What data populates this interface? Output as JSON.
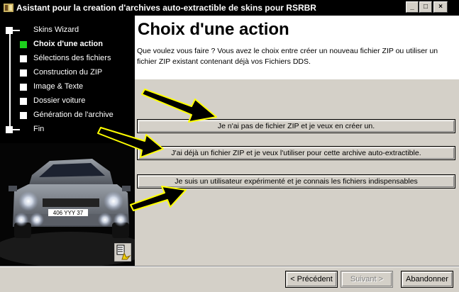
{
  "window": {
    "title": "Asistant pour la creation d'archives auto-extractible de skins pour RSRBR",
    "minimize_glyph": "_",
    "maximize_glyph": "□",
    "close_glyph": "×"
  },
  "steps": [
    {
      "label": "Skins Wizard",
      "active": false
    },
    {
      "label": "Choix d'une action",
      "active": true
    },
    {
      "label": "Sélections des fichiers",
      "active": false
    },
    {
      "label": "Construction du ZIP",
      "active": false
    },
    {
      "label": "Image & Texte",
      "active": false
    },
    {
      "label": "Dossier voiture",
      "active": false
    },
    {
      "label": "Génération de l'archive",
      "active": false
    },
    {
      "label": "Fin",
      "active": false
    }
  ],
  "header": {
    "title": "Choix d'une action",
    "description": "Que voulez vous faire ? Vous avez le choix entre créer un nouveau fichier ZIP ou utiliser un fichier ZIP existant contenant déjà vos Fichiers DDS."
  },
  "actions": {
    "new_zip": "Je n'ai pas de fichier ZIP et je veux en créer un.",
    "existing_zip": "J'ai déjà un fichier ZIP et je veux l'utiliser pour cette archive auto-extractible.",
    "expert": "Je suis un utilisateur expérimenté et je connais les fichiers indispensables"
  },
  "footer": {
    "previous": "< Précédent",
    "next": "Suivant >",
    "cancel": "Abandonner"
  },
  "car": {
    "plate": "406 YYY 37"
  },
  "colors": {
    "active_step": "#1dd11d",
    "arrow_fill": "#000000",
    "arrow_outline": "#ffff00",
    "button_face": "#d4d0c8"
  }
}
